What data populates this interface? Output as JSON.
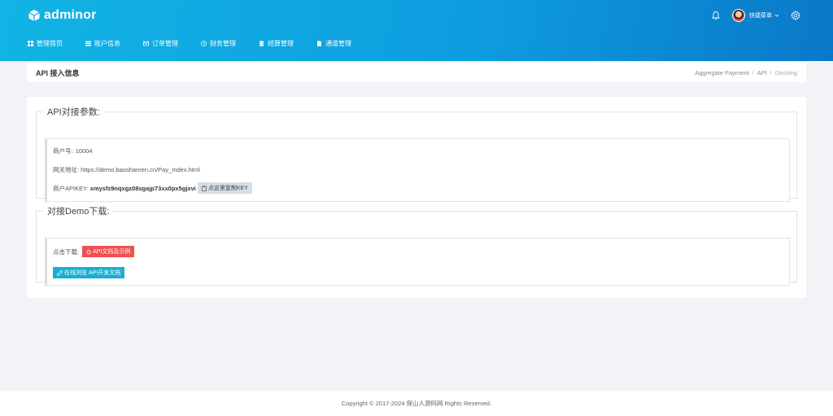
{
  "app": {
    "logo_text": "adminor",
    "user_menu_label": "快捷菜单"
  },
  "nav": [
    {
      "label": "管理首页",
      "icon": "dashboard-icon"
    },
    {
      "label": "账户信息",
      "icon": "list-icon"
    },
    {
      "label": "订单管理",
      "icon": "mail-icon"
    },
    {
      "label": "财务管理",
      "icon": "clock-icon"
    },
    {
      "label": "结算管理",
      "icon": "stack-icon"
    },
    {
      "label": "通道管理",
      "icon": "file-icon"
    }
  ],
  "page": {
    "title": "API 接入信息",
    "breadcrumb": [
      "Aggregate Payment",
      "API",
      "Docking"
    ]
  },
  "api_params": {
    "legend": "API对接参数:",
    "merchant_label": "商户号:",
    "merchant_value": "10004",
    "gateway_label": "网关地址:",
    "gateway_value": "https://demo.baoshanren.cn/Pay_Index.html",
    "apikey_label": "商户APIKEY:",
    "apikey_value": "xmysfz9nqxgz08sgajp73xx0px5gjxvi",
    "copy_button": "点这里复制KEY"
  },
  "demo": {
    "legend": "对接Demo下载:",
    "download_label": "点击下载:",
    "download_button": "API文档及示例",
    "browse_button": "在线浏览 API开发文档"
  },
  "footer": {
    "text": "Copyright © 2017-2024 保山人源码网 Rights Reserved."
  },
  "colors": {
    "header_start": "#11b4e4",
    "header_end": "#0a78c8",
    "danger": "#f05050",
    "info": "#19aed1"
  }
}
